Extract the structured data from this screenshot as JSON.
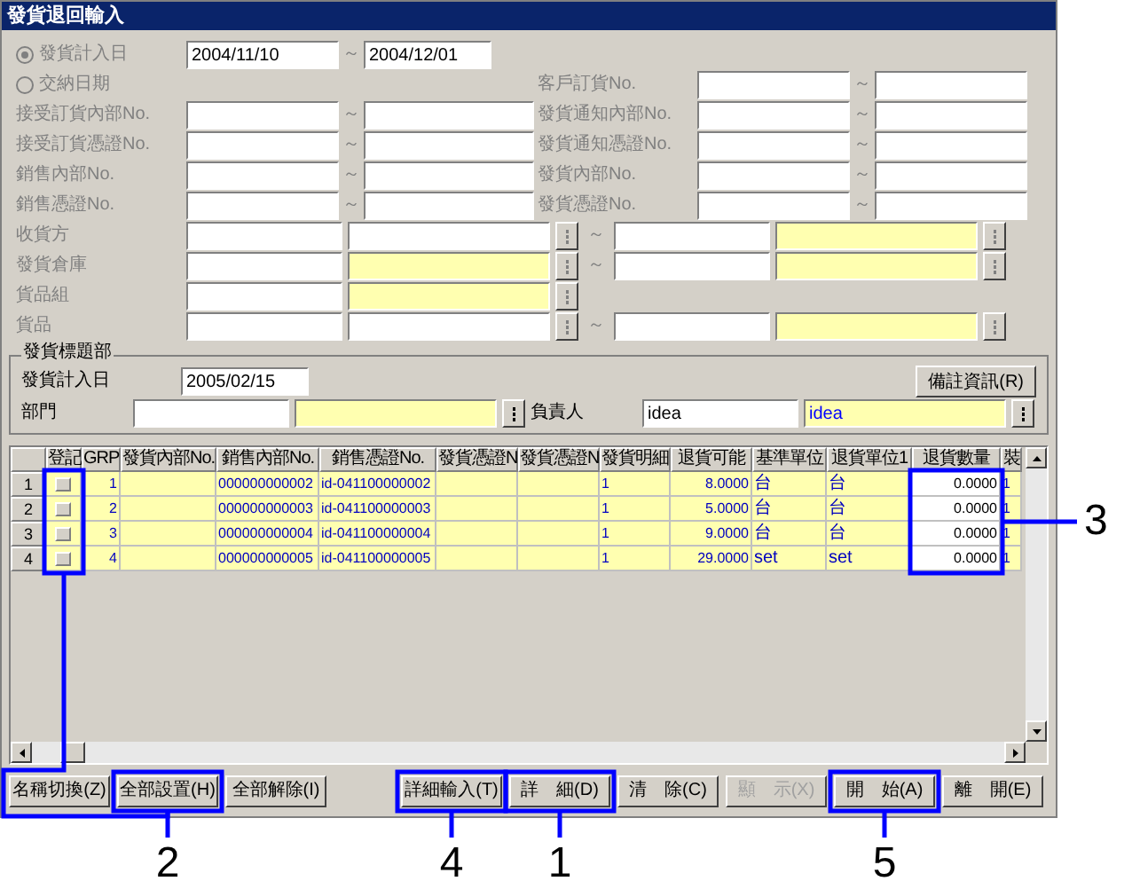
{
  "window": {
    "title": "發貨退回輸入"
  },
  "filter": {
    "disabled": true,
    "date_options": [
      {
        "label": "發貨計入日",
        "selected": true
      },
      {
        "label": "交納日期",
        "selected": false
      }
    ],
    "date_from": "2004/11/10",
    "date_separator": "～",
    "date_to": "2004/12/01",
    "left_ranges": [
      {
        "label": "接受訂貨內部No.",
        "separator": "～"
      },
      {
        "label": "接受訂貨憑證No.",
        "separator": "～"
      },
      {
        "label": "銷售內部No.",
        "separator": "～"
      },
      {
        "label": "銷售憑證No.",
        "separator": "～"
      }
    ],
    "right_ranges": [
      {
        "label": "客戶訂貨No.",
        "separator": "～"
      },
      {
        "label": "發貨通知內部No.",
        "separator": "～"
      },
      {
        "label": "發貨通知憑證No.",
        "separator": "～"
      },
      {
        "label": "發貨內部No.",
        "separator": "～"
      },
      {
        "label": "發貨憑證No.",
        "separator": "～"
      }
    ],
    "lookups": [
      {
        "label": "收貨方",
        "name_highlighted": false,
        "separator": "～",
        "to_highlighted": true
      },
      {
        "label": "發貨倉庫",
        "name_highlighted": true,
        "separator": "～",
        "to_highlighted": true
      },
      {
        "label": "貨品組",
        "name_highlighted": true
      },
      {
        "label": "貨品",
        "name_highlighted": false,
        "separator": "～",
        "to_highlighted": true
      }
    ]
  },
  "header": {
    "title": "發貨標題部",
    "date_label": "發貨計入日",
    "date": "2005/02/15",
    "note_button": "備註資訊(R)",
    "department_label": "部門",
    "person_label": "負責人",
    "person_code": "idea",
    "person_name": "idea"
  },
  "table": {
    "columns": [
      {
        "label": "登記",
        "kind": "checkbox",
        "callout_box": true
      },
      {
        "label": "GRP",
        "kind": "number"
      },
      {
        "label": "發貨內部No.",
        "kind": "text"
      },
      {
        "label": "銷售內部No.",
        "kind": "text"
      },
      {
        "label": "銷售憑證No.",
        "kind": "text"
      },
      {
        "label": "發貨憑證N",
        "kind": "text"
      },
      {
        "label": "發貨憑證N",
        "kind": "text"
      },
      {
        "label": "發貨明細",
        "kind": "text"
      },
      {
        "label": "退貨可能",
        "kind": "number"
      },
      {
        "label": "基準單位",
        "kind": "unit"
      },
      {
        "label": "退貨單位1",
        "kind": "unit"
      },
      {
        "label": "退貨數量",
        "kind": "entry",
        "callout": "3"
      },
      {
        "label": "裝",
        "kind": "text"
      }
    ],
    "rows": [
      {
        "row_header": "1",
        "checked": false,
        "cells": [
          "",
          "1",
          "",
          "000000000002",
          "id-041100000002",
          "",
          "",
          "1",
          "8.0000",
          "台",
          "台",
          "0.0000",
          "1"
        ]
      },
      {
        "row_header": "2",
        "checked": false,
        "cells": [
          "",
          "2",
          "",
          "000000000003",
          "id-041100000003",
          "",
          "",
          "1",
          "5.0000",
          "台",
          "台",
          "0.0000",
          "1"
        ]
      },
      {
        "row_header": "3",
        "checked": false,
        "cells": [
          "",
          "3",
          "",
          "000000000004",
          "id-041100000004",
          "",
          "",
          "1",
          "9.0000",
          "台",
          "台",
          "0.0000",
          "1"
        ]
      },
      {
        "row_header": "4",
        "checked": false,
        "cells": [
          "",
          "4",
          "",
          "000000000005",
          "id-041100000005",
          "",
          "",
          "1",
          "29.0000",
          "set",
          "set",
          "0.0000",
          "1"
        ]
      }
    ]
  },
  "buttons_left": [
    {
      "label": "名稱切換(Z)",
      "disabled": false
    },
    {
      "label": "全部設置(H)",
      "disabled": false,
      "callout": "2"
    },
    {
      "label": "全部解除(I)",
      "disabled": false
    }
  ],
  "buttons_right": [
    {
      "label": "詳細輸入(T)",
      "disabled": false,
      "callout": "4"
    },
    {
      "label": "詳　細(D)",
      "disabled": false,
      "callout": "1"
    },
    {
      "label": "清　除(C)",
      "disabled": false
    },
    {
      "label": "顯　示(X)",
      "disabled": true
    },
    {
      "label": "開　始(A)",
      "disabled": false,
      "callout": "5"
    },
    {
      "label": "離　開(E)",
      "disabled": false
    }
  ]
}
